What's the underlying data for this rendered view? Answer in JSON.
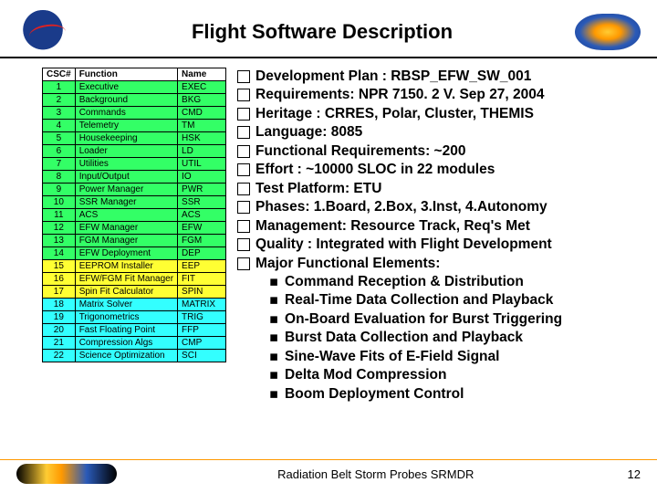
{
  "header": {
    "title": "Flight Software Description"
  },
  "table": {
    "headers": [
      "CSC#",
      "Function",
      "Name"
    ],
    "rows": [
      {
        "n": "1",
        "func": "Executive",
        "name": "EXEC",
        "cls": "green"
      },
      {
        "n": "2",
        "func": "Background",
        "name": "BKG",
        "cls": "green"
      },
      {
        "n": "3",
        "func": "Commands",
        "name": "CMD",
        "cls": "green"
      },
      {
        "n": "4",
        "func": "Telemetry",
        "name": "TM",
        "cls": "green"
      },
      {
        "n": "5",
        "func": "Housekeeping",
        "name": "HSK",
        "cls": "green"
      },
      {
        "n": "6",
        "func": "Loader",
        "name": "LD",
        "cls": "green"
      },
      {
        "n": "7",
        "func": "Utilities",
        "name": "UTIL",
        "cls": "green"
      },
      {
        "n": "8",
        "func": "Input/Output",
        "name": "IO",
        "cls": "green"
      },
      {
        "n": "9",
        "func": "Power Manager",
        "name": "PWR",
        "cls": "green"
      },
      {
        "n": "10",
        "func": "SSR Manager",
        "name": "SSR",
        "cls": "green"
      },
      {
        "n": "11",
        "func": "ACS",
        "name": "ACS",
        "cls": "green"
      },
      {
        "n": "12",
        "func": "EFW Manager",
        "name": "EFW",
        "cls": "green"
      },
      {
        "n": "13",
        "func": "FGM Manager",
        "name": "FGM",
        "cls": "green"
      },
      {
        "n": "14",
        "func": "EFW Deployment",
        "name": "DEP",
        "cls": "green"
      },
      {
        "n": "15",
        "func": "EEPROM Installer",
        "name": "EEP",
        "cls": "yellow"
      },
      {
        "n": "16",
        "func": "EFW/FGM Fit Manager",
        "name": "FIT",
        "cls": "yellow"
      },
      {
        "n": "17",
        "func": "Spin Fit Calculator",
        "name": "SPIN",
        "cls": "yellow"
      },
      {
        "n": "18",
        "func": "Matrix Solver",
        "name": "MATRIX",
        "cls": "cyan"
      },
      {
        "n": "19",
        "func": "Trigonometrics",
        "name": "TRIG",
        "cls": "cyan"
      },
      {
        "n": "20",
        "func": "Fast Floating Point",
        "name": "FFP",
        "cls": "cyan"
      },
      {
        "n": "21",
        "func": "Compression Algs",
        "name": "CMP",
        "cls": "cyan"
      },
      {
        "n": "22",
        "func": "Science Optimization",
        "name": "SCI",
        "cls": "cyan"
      }
    ]
  },
  "bullets": [
    "Development Plan : RBSP_EFW_SW_001",
    "Requirements: NPR 7150. 2 V. Sep 27, 2004",
    "Heritage : CRRES, Polar, Cluster, THEMIS",
    "Language: 8085",
    "Functional Requirements: ~200",
    "Effort : ~10000 SLOC in 22 modules",
    "Test Platform: ETU",
    "Phases: 1.Board, 2.Box, 3.Inst, 4.Autonomy",
    "Management: Resource Track, Req's Met",
    "Quality : Integrated with Flight Development",
    "Major Functional Elements:"
  ],
  "subbullets": [
    "Command Reception & Distribution",
    "Real-Time Data Collection and Playback",
    "On-Board Evaluation for Burst Triggering",
    "Burst Data Collection and Playback",
    "Sine-Wave Fits of E-Field Signal",
    "Delta Mod Compression",
    "Boom Deployment Control"
  ],
  "footer": {
    "text": "Radiation Belt Storm Probes SRMDR",
    "page": "12"
  }
}
